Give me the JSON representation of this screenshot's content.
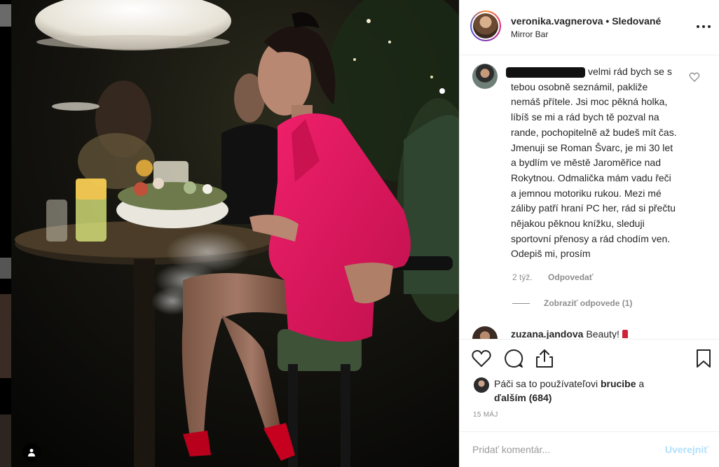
{
  "post": {
    "username": "veronika.vagnerova",
    "separator": "•",
    "follow_status": "Sledované",
    "location": "Mirror Bar"
  },
  "comments": [
    {
      "username_redacted": true,
      "text": "velmi rád bych se s tebou osobně seznámil, pakliže nemáš přítele. Jsi moc pěkná holka, líbíš se mi a rád bych tě pozval na rande, pochopitelně až budeš mít čas. Jmenuji se Roman Švarc, je mi 30 let a bydlím ve městě Jaroměřice nad Rokytnou. Odmalička mám vadu řeči a jemnou motoriku rukou. Mezi mé záliby patří hraní PC her, rád si přečtu nějakou pěknou knížku, sleduji sportovní přenosy a rád chodím ven. Odepiš mi, prosím",
      "age": "2 týž.",
      "reply_label": "Odpovedať",
      "view_replies_label": "Zobraziť odpovede (1)"
    },
    {
      "username": "zuzana.jandova",
      "text": "Beauty!"
    }
  ],
  "likes": {
    "prefix": "Páči sa to používateľovi",
    "user": "brucibe",
    "middle": "a",
    "others": "ďalším (684)"
  },
  "date": "15 MÁJ",
  "add_comment": {
    "placeholder": "Pridať komentár...",
    "post_label": "Uverejniť"
  },
  "icons": {
    "more": "more-options-icon",
    "like": "heart-icon",
    "comment": "comment-icon",
    "share": "share-icon",
    "save": "bookmark-icon",
    "tag": "user-tag-icon"
  },
  "colors": {
    "text": "#262626",
    "muted": "#8e8e8e",
    "border": "#efefef",
    "post_disabled": "#b2dffc",
    "blazer": "#e5185e"
  }
}
